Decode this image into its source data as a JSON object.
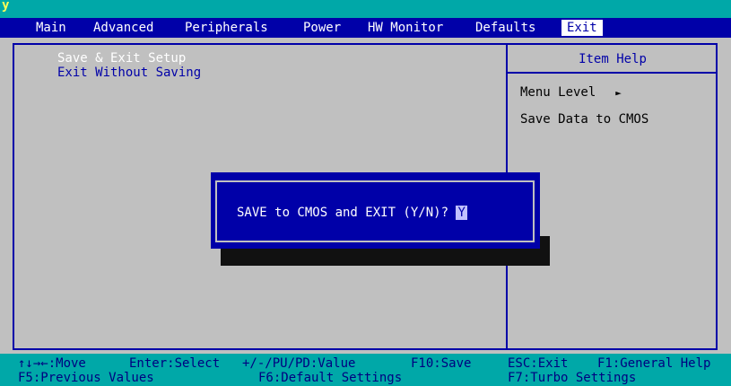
{
  "corner_char": "y",
  "menu": {
    "items": [
      "Main",
      "Advanced",
      "Peripherals",
      "Power",
      "HW Monitor",
      "Defaults",
      "Exit"
    ]
  },
  "options": [
    "Save & Exit Setup",
    "Exit Without Saving"
  ],
  "help": {
    "title": "Item Help",
    "menu_level": "Menu Level",
    "arrow": "►",
    "description": "Save Data to CMOS"
  },
  "dialog": {
    "prompt": "SAVE to CMOS and EXIT (Y/N)?",
    "value": "Y"
  },
  "bottom": {
    "row1": [
      "↑↓→←:Move",
      "Enter:Select",
      "+/-/PU/PD:Value",
      "F10:Save",
      "ESC:Exit",
      "F1:General Help"
    ],
    "row2": [
      "F5:Previous Values",
      "F6:Default Settings",
      "F7:Turbo Settings"
    ]
  },
  "colors": {
    "menu_bg": "#0000a8",
    "top_bg": "#00a8a8",
    "panel_bg": "#c0c0c0",
    "dialog_bg": "#0000a8"
  }
}
